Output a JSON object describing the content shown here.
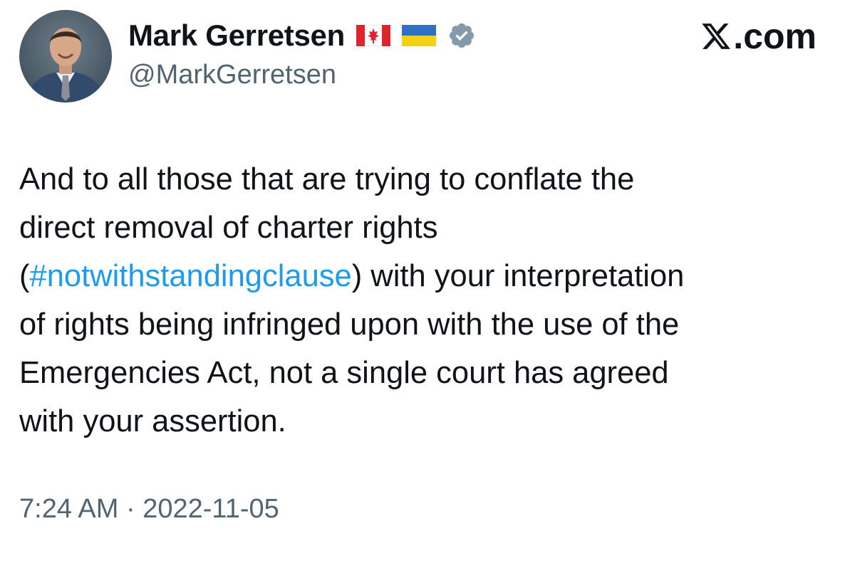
{
  "author": {
    "display_name": "Mark Gerretsen",
    "handle": "@MarkGerretsen",
    "badges": [
      "canada-flag-icon",
      "ukraine-flag-icon",
      "verified-badge-icon"
    ]
  },
  "brand": {
    "icon": "x-logo-icon",
    "suffix": ".com"
  },
  "tweet": {
    "line1": "And to all those that are trying to conflate the",
    "line2": "direct removal of charter rights",
    "line3_open": "(",
    "line3_hashtag": "#notwithstandingclause",
    "line3_rest": ") with your interpretation",
    "line4": "of rights being infringed upon with the use of the",
    "line5": "Emergencies Act, not a single court has agreed",
    "line6": "with your assertion."
  },
  "timestamp": "7:24 AM · 2022-11-05",
  "colors": {
    "text": "#0f1419",
    "secondary": "#536471",
    "link": "#1d9bf0",
    "verified_badge": "#829aab"
  }
}
